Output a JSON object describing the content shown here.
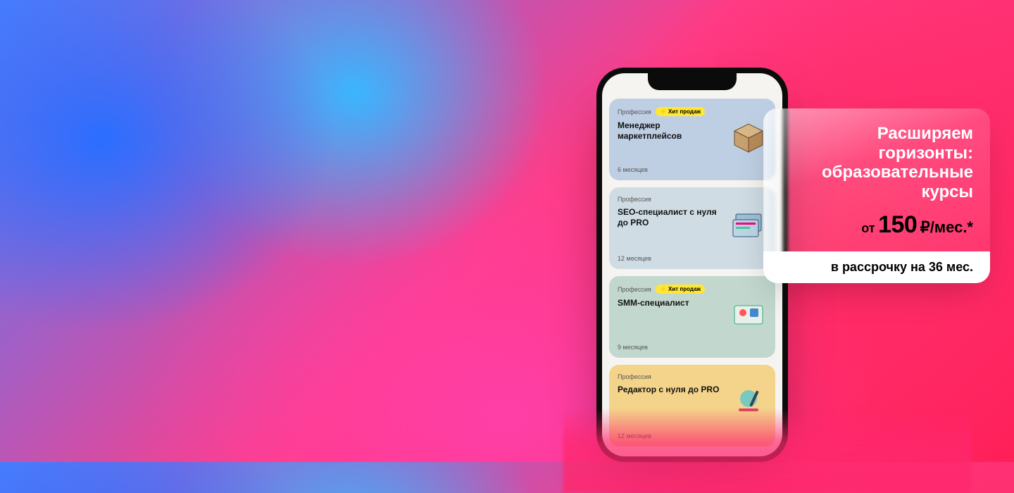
{
  "promo": {
    "headline": "Расширяем горизонты: образовательные курсы",
    "price_from": "от",
    "price_amount": "150",
    "price_unit": "₽/мес.*",
    "strip": "в рассрочку на 36 мес."
  },
  "hit_badge": "⚡ Хит продаж",
  "category_label": "Профессия",
  "cards": [
    {
      "title": "Менеджер маркетплейсов",
      "duration": "6 месяцев",
      "hit": true
    },
    {
      "title": "SEO-специалист с нуля до PRO",
      "duration": "12 месяцев",
      "hit": false
    },
    {
      "title": "SMM-специалист",
      "duration": "9 месяцев",
      "hit": true
    },
    {
      "title": "Редактор с нуля до PRO",
      "duration": "12 месяцев",
      "hit": false
    }
  ]
}
